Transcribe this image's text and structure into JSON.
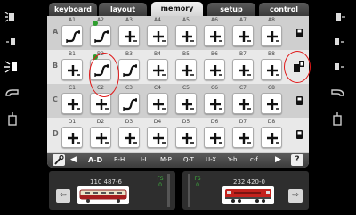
{
  "tabs": [
    {
      "label": "keyboard",
      "active": false
    },
    {
      "label": "layout",
      "active": false
    },
    {
      "label": "memory",
      "active": true
    },
    {
      "label": "setup",
      "active": false
    },
    {
      "label": "control",
      "active": false
    }
  ],
  "rows": [
    {
      "label": "A",
      "cells": [
        {
          "id": "A1",
          "icon": "route-icon",
          "led": false
        },
        {
          "id": "A2",
          "icon": "route-icon",
          "led": true
        },
        {
          "id": "A3",
          "icon": "plus-icon",
          "led": false
        },
        {
          "id": "A4",
          "icon": "plus-icon",
          "led": false
        },
        {
          "id": "A5",
          "icon": "plus-icon",
          "led": false
        },
        {
          "id": "A6",
          "icon": "plus-icon",
          "led": false
        },
        {
          "id": "A7",
          "icon": "plus-icon",
          "led": false
        },
        {
          "id": "A8",
          "icon": "plus-icon",
          "led": false
        }
      ]
    },
    {
      "label": "B",
      "cells": [
        {
          "id": "B1",
          "icon": "plus-icon",
          "led": false
        },
        {
          "id": "B2",
          "icon": "route-icon",
          "led": true
        },
        {
          "id": "B3",
          "icon": "route-icon",
          "led": false
        },
        {
          "id": "B4",
          "icon": "plus-icon",
          "led": false
        },
        {
          "id": "B5",
          "icon": "plus-icon",
          "led": false
        },
        {
          "id": "B6",
          "icon": "plus-icon",
          "led": false
        },
        {
          "id": "B7",
          "icon": "plus-icon",
          "led": false
        },
        {
          "id": "B8",
          "icon": "plus-icon",
          "led": false
        }
      ]
    },
    {
      "label": "C",
      "cells": [
        {
          "id": "C1",
          "icon": "plus-icon",
          "led": false
        },
        {
          "id": "C2",
          "icon": "plus-icon",
          "led": false
        },
        {
          "id": "C3",
          "icon": "route-icon",
          "led": false
        },
        {
          "id": "C4",
          "icon": "plus-icon",
          "led": false
        },
        {
          "id": "C5",
          "icon": "plus-icon",
          "led": false
        },
        {
          "id": "C6",
          "icon": "plus-icon",
          "led": false
        },
        {
          "id": "C7",
          "icon": "plus-icon",
          "led": false
        },
        {
          "id": "C8",
          "icon": "plus-icon",
          "led": false
        }
      ]
    },
    {
      "label": "D",
      "cells": [
        {
          "id": "D1",
          "icon": "plus-icon",
          "led": false
        },
        {
          "id": "D2",
          "icon": "plus-icon",
          "led": false
        },
        {
          "id": "D3",
          "icon": "plus-icon",
          "led": false
        },
        {
          "id": "D4",
          "icon": "plus-icon",
          "led": false
        },
        {
          "id": "D5",
          "icon": "plus-icon",
          "led": false
        },
        {
          "id": "D6",
          "icon": "plus-icon",
          "led": false
        },
        {
          "id": "D7",
          "icon": "plus-icon",
          "led": false
        },
        {
          "id": "D8",
          "icon": "plus-icon",
          "led": false
        }
      ]
    }
  ],
  "filter": {
    "tool_icon": "wrench-icon",
    "items": [
      {
        "label": "A-D",
        "active": true
      },
      {
        "label": "E-H",
        "active": false
      },
      {
        "label": "I-L",
        "active": false
      },
      {
        "label": "M-P",
        "active": false
      },
      {
        "label": "Q-T",
        "active": false
      },
      {
        "label": "U-X",
        "active": false
      },
      {
        "label": "Y-b",
        "active": false
      },
      {
        "label": "c-f",
        "active": false
      }
    ],
    "help_label": "?"
  },
  "locos": {
    "left": {
      "name": "110 487-6",
      "fs": "FS",
      "speed": "0"
    },
    "right": {
      "name": "232 420-0",
      "fs": "FS",
      "speed": "0"
    }
  },
  "colors": {
    "led_green": "#2e9e2e",
    "annotation_red": "#e01a1a",
    "fs_green": "#3fb33f",
    "active_tab_bg": "#e6e6e6"
  }
}
